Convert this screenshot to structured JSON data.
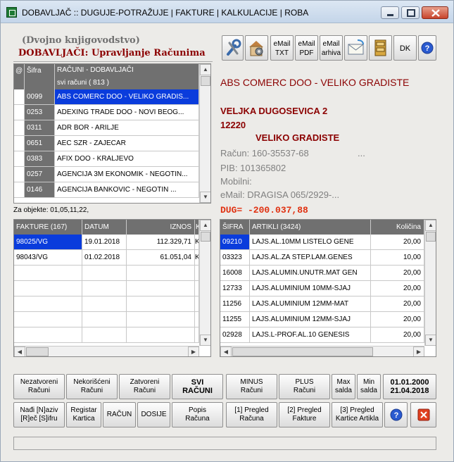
{
  "window": {
    "title": "DOBAVLJAČ :: DUGUJE-POTRAŽUJE | FAKTURE | KALKULACIJE | ROBA"
  },
  "header": {
    "subtitle": "(Dvojno knjigovodstvo)",
    "heading": "DOBAVLJAČI: Upravljanje Računima"
  },
  "toolbar": {
    "email_txt_l1": "eMail",
    "email_txt_l2": "TXT",
    "email_pdf_l1": "eMail",
    "email_pdf_l2": "PDF",
    "email_arh_l1": "eMail",
    "email_arh_l2": "arhiva",
    "dk": "DK"
  },
  "suppliers": {
    "col_at": "@",
    "col_sifra": "Šifra",
    "col_name": "RAČUNI - DOBAVLJAČI",
    "col_sub": "svi računi  ( 813 )",
    "rows": [
      {
        "code": "0099",
        "name": "ABS COMERC DOO - VELIKO GRADIS..."
      },
      {
        "code": "0253",
        "name": "ADEXING TRADE DOO - NOVI BEOG..."
      },
      {
        "code": "0311",
        "name": "ADR BOR - ARILJE"
      },
      {
        "code": "0651",
        "name": "AEC SZR - ZAJECAR"
      },
      {
        "code": "0383",
        "name": "AFIX DOO - KRALJEVO"
      },
      {
        "code": "0257",
        "name": "AGENCIJA 3M EKONOMIK - NEGOTIN..."
      },
      {
        "code": "0146",
        "name": "AGENCIJA BANKOVIC - NEGOTIN    ..."
      }
    ]
  },
  "za_objekte": "Za objekte: 01,05,11,22,",
  "invoices": {
    "col_fakture": "FAKTURE  (167)",
    "col_datum": "DATUM",
    "col_iznos": "IZNOS",
    "col_k": "K",
    "rows": [
      {
        "no": "98025/VG",
        "date": "19.01.2018",
        "amount": "112.329,71",
        "k": "K"
      },
      {
        "no": "98043/VG",
        "date": "01.02.2018",
        "amount": "61.051,04",
        "k": "K"
      }
    ]
  },
  "supplier_info": {
    "name": "ABS COMERC DOO - VELIKO GRADISTE",
    "street": "VELJKA DUGOSEVICA 2",
    "zip": "12220",
    "city": "VELIKO GRADISTE",
    "racun": "Račun: 160-35537-68",
    "racun_extra": "...",
    "pib": "PIB: 101365802",
    "mobilni": "Mobilni:",
    "email": "eMail:   DRAGISA 065/2929-...",
    "dug": "DUG=  -200.037,88"
  },
  "articles": {
    "col_sifra": "ŠIFRA",
    "col_name": "ARTIKLI  (3424)",
    "col_qty": "Količina",
    "rows": [
      {
        "code": "09210",
        "name": "LAJS.AL.10MM LISTELO GENE",
        "qty": "20,00"
      },
      {
        "code": "03323",
        "name": "LAJS.AL.ZA STEP.LAM.GENES",
        "qty": "10,00"
      },
      {
        "code": "16008",
        "name": "LAJS.ALUMIN.UNUTR.MAT GEN",
        "qty": "20,00"
      },
      {
        "code": "12733",
        "name": "LAJS.ALUMINIUM 10MM-SJAJ",
        "qty": "20,00"
      },
      {
        "code": "11256",
        "name": "LAJS.ALUMINIUM 12MM-MAT",
        "qty": "20,00"
      },
      {
        "code": "11255",
        "name": "LAJS.ALUMINIUM 12MM-SJAJ",
        "qty": "20,00"
      },
      {
        "code": "02928",
        "name": "LAJS.L-PROF.AL.10 GENESIS",
        "qty": "20,00"
      }
    ]
  },
  "buttons_row1": {
    "nezatvoreni_1": "Nezatvoreni",
    "nezatvoreni_2": "Računi",
    "nekorisceni_1": "Nekorišćeni",
    "nekorisceni_2": "Računi",
    "zatvoreni_1": "Zatvoreni",
    "zatvoreni_2": "Računi",
    "svi_1": "SVI",
    "svi_2": "RAČUNI",
    "minus_1": "MINUS",
    "minus_2": "Računi",
    "plus_1": "PLUS",
    "plus_2": "Računi",
    "max_1": "Max",
    "max_2": "salda",
    "min_1": "Min",
    "min_2": "salda",
    "date_from": "01.01.2000",
    "date_to": "21.04.2018"
  },
  "buttons_row2": {
    "nadji_1": "Nađi [N]aziv",
    "nadji_2": "[R]eč [S]ifru",
    "registar_1": "Registar",
    "registar_2": "Kartica",
    "racun": "RAČUN",
    "dosije": "DOSIJE",
    "popis_1": "Popis",
    "popis_2": "Računa",
    "pregled1_1": "[1] Pregled",
    "pregled1_2": "Računa",
    "pregled2_1": "[2] Pregled",
    "pregled2_2": "Fakture",
    "pregled3_1": "[3] Pregled",
    "pregled3_2": "Kartice Artikla"
  },
  "colors": {
    "heading": "#8b0000",
    "selection": "#0a3cdc",
    "dug": "#e03010",
    "grid_header": "#707070"
  }
}
